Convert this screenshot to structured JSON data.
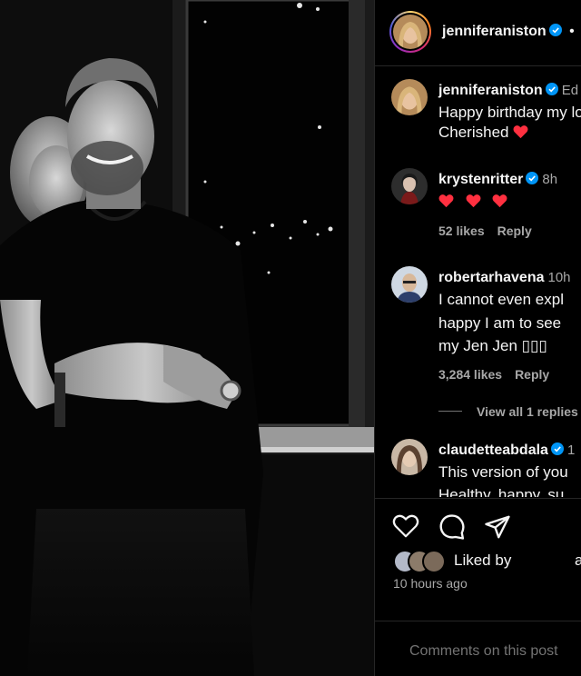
{
  "post": {
    "username": "jenniferaniston",
    "verified_icon": "verified-badge-icon",
    "more_dot": "•",
    "accent": "#0095f6",
    "heart_color": "#ff3040"
  },
  "caption": {
    "username": "jenniferaniston",
    "time": "Ed",
    "line1": "Happy birthday my lo",
    "line2": "Cherished"
  },
  "comments": [
    {
      "username": "krystenritter",
      "time": "8h",
      "hearts": 3,
      "likes": "52 likes",
      "reply": "Reply"
    },
    {
      "username": "robertarhavena",
      "time": "10h",
      "lines": [
        "I cannot even expl",
        "happy I am to see",
        "my Jen Jen ▯▯▯"
      ],
      "likes": "3,284 likes",
      "reply": "Reply",
      "view_replies": "View all 1 replies"
    },
    {
      "username": "claudetteabdala",
      "time": "1",
      "lines": [
        "This version of you",
        "Healthy, happy, su"
      ]
    }
  ],
  "actions": {
    "like_icon": "heart-icon",
    "comment_icon": "comment-icon",
    "share_icon": "share-icon",
    "liked_by": "Liked by",
    "liked_by_suffix": "a",
    "timestamp": "10 hours ago"
  },
  "add_comment": {
    "placeholder": "Comments on this post"
  }
}
